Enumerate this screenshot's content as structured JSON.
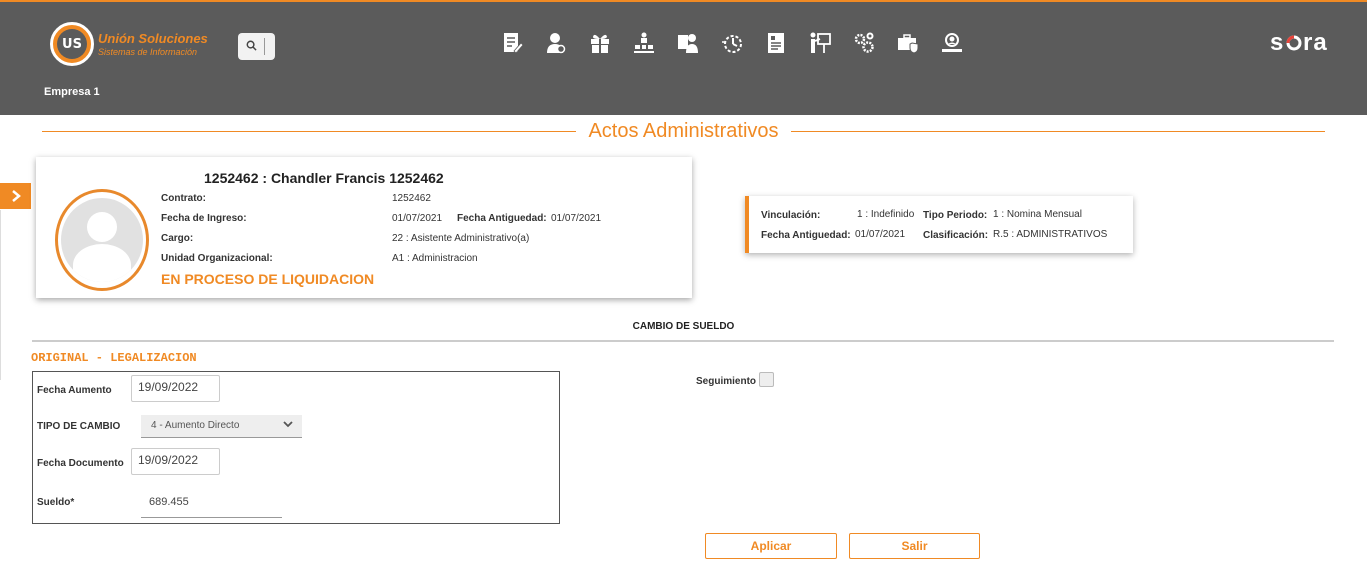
{
  "header": {
    "logo_mark": "US",
    "logo_line1": "Unión Soluciones",
    "logo_line2": "Sistemas de Información",
    "brand": "sora",
    "company": "Empresa 1",
    "nav_icons": [
      "document-edit-icon",
      "user-badge-icon",
      "gift-icon",
      "hierarchy-icon",
      "user-clipboard-icon",
      "timer-icon",
      "payslip-icon",
      "training-icon",
      "settings-gears-icon",
      "briefcase-shield-icon",
      "user-search-icon"
    ]
  },
  "page": {
    "title": "Actos Administrativos"
  },
  "employee": {
    "name": "1252462 : Chandler Francis 1252462",
    "contrato_label": "Contrato:",
    "contrato": "1252462",
    "fecha_ingreso_label": "Fecha de Ingreso:",
    "fecha_ingreso": "01/07/2021",
    "fecha_antiguedad_label": "Fecha Antiguedad:",
    "fecha_antiguedad": "01/07/2021",
    "cargo_label": "Cargo:",
    "cargo": "22 : Asistente Administrativo(a)",
    "unidad_label": "Unidad Organizacional:",
    "unidad": "A1 : Administracion",
    "status": "EN PROCESO DE LIQUIDACION"
  },
  "info": {
    "vinculacion_label": "Vinculación:",
    "vinculacion": "1 : Indefinido",
    "tipo_periodo_label": "Tipo Periodo:",
    "tipo_periodo": "1 : Nomina Mensual",
    "fecha_antiguedad_label": "Fecha Antiguedad:",
    "fecha_antiguedad": "01/07/2021",
    "clasificacion_label": "Clasificación:",
    "clasificacion": "R.5 : ADMINISTRATIVOS"
  },
  "form": {
    "section_title": "CAMBIO DE SUELDO",
    "group_label": "ORIGINAL - LEGALIZACION",
    "fecha_aumento_label": "Fecha Aumento",
    "fecha_aumento": "19/09/2022",
    "tipo_cambio_label": "TIPO DE CAMBIO",
    "tipo_cambio": "4 - Aumento Directo",
    "fecha_documento_label": "Fecha Documento",
    "fecha_documento": "19/09/2022",
    "sueldo_label": "Sueldo*",
    "sueldo": "689.455",
    "seguimiento_label": "Seguimiento",
    "seguimiento_checked": false,
    "apply_label": "Aplicar",
    "exit_label": "Salir"
  },
  "colors": {
    "accent": "#f08a24",
    "header_bg": "#5b5b5b"
  }
}
